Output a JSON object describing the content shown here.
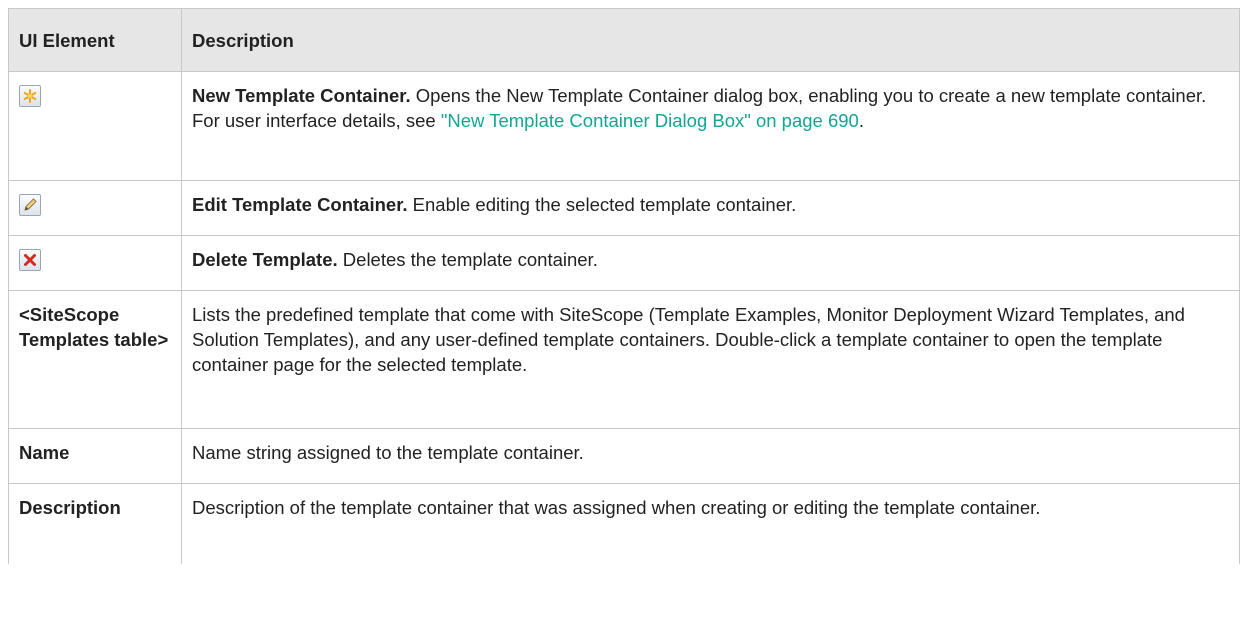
{
  "header": {
    "col1": "UI Element",
    "col2": "Description"
  },
  "rows": [
    {
      "icon": "new-template-container-icon",
      "title": "New Template Container.",
      "desc": " Opens the New Template Container dialog box, enabling you to create a new template container. For user interface details, see ",
      "link": "\"New Template Container Dialog Box\" on page 690",
      "tail": "."
    },
    {
      "icon": "edit-pencil-icon",
      "title": "Edit Template Container.",
      "desc": " Enable editing the selected template container."
    },
    {
      "icon": "delete-x-icon",
      "title": "Delete Template.",
      "desc": " Deletes the template container."
    },
    {
      "element": "<SiteScope Templates table>",
      "desc": "Lists the predefined template that come with SiteScope (Template Examples, Monitor Deployment Wizard Templates, and Solution Templates), and any user-defined template containers. Double-click a template container to open the template container page for the selected template."
    },
    {
      "element": "Name",
      "desc": "Name string assigned to the template container."
    },
    {
      "element": "Description",
      "desc": "Description of the template container that was assigned when creating or editing the template container."
    }
  ],
  "colors": {
    "link": "#12a594",
    "header_bg": "#e6e6e6",
    "border": "#c8c8c8"
  }
}
